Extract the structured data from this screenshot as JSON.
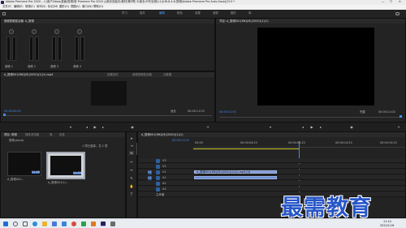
{
  "window": {
    "title": "Adobe Premiere Pro 2020 - 八/用户/ldiao/桌面/剪辑/剪 Premiere Pro 2020 从新手到高手/素材/第9章/ 8.新手/0节/实例(L1)/LRL8.4.8-剪辑(Adobe Premiere Pro Auto-Save)[213 *"
  },
  "menu": [
    "文件(F)",
    "编辑(E)",
    "剪辑(C)",
    "序列(S)",
    "标记(M)",
    "图形(G)",
    "视图(V)",
    "窗口(W)",
    "帮助(H)"
  ],
  "workspaces": [
    {
      "label": "学习",
      "active": false
    },
    {
      "label": "组件",
      "active": false
    },
    {
      "label": "编辑",
      "active": true
    },
    {
      "label": "颜色",
      "active": false
    },
    {
      "label": "效果",
      "active": false
    },
    {
      "label": "音频",
      "active": false
    },
    {
      "label": "图形",
      "active": false
    },
    {
      "label": "库",
      "active": false
    }
  ],
  "audio_mixer": {
    "tab": "音频剪辑混合器: A_剪辑",
    "channels": [
      "音频 1",
      "音频 2",
      "音频 3",
      "音频 4"
    ]
  },
  "source_tabs": [
    "A_剪辑001(MK)(M)(2020)(1)(1).mp4",
    "效果控件",
    "音频剪辑混合器",
    "元数据"
  ],
  "source": {
    "timecode_left": "00:00:00:00",
    "timecode_right": "00:00:11:03",
    "zoom": "适合"
  },
  "program": {
    "tab": "节目: A_剪辑001(MK)(M)(2020)(1)(1)",
    "timecode_left": "00:00:11:03",
    "timecode_right": "00:00:11:03",
    "quality": "完整"
  },
  "project": {
    "tabs": [
      "项目: 剪辑",
      "媒体浏览器",
      "库",
      "信息"
    ],
    "folder": "剪辑.prproj",
    "items_selected": "1 项已选择，共 2 项",
    "clips": [
      {
        "name": "A_剪辑001...",
        "duration": "11:03"
      },
      {
        "name": "A_剪辑001(1)...",
        "duration": "11:03"
      }
    ]
  },
  "timeline": {
    "tab": "A_剪辑001(MK)(M)(2020)(1)(1)",
    "timecode": "00:00:11:03",
    "ruler": [
      "00:00",
      "00:00:04:23",
      "00:00:09:23",
      "00:00:14:23",
      "00:00:19:23"
    ],
    "video_tracks": [
      "V3",
      "V2",
      "V1"
    ],
    "audio_tracks": [
      "A1",
      "A2",
      "A3"
    ],
    "master": "主声道",
    "video_clip": "A_剪辑001(MK)(M)(2020)(1)(1).mp4 [V]",
    "context_menu": [
      "快速编辑工具",
      "波纹编辑工具",
      "滚动编辑工具"
    ]
  },
  "taskbar": {
    "time": "11:14",
    "date": "2022/1/18"
  },
  "watermark": "最需教育",
  "colors": {
    "accent": "#3e8ef0",
    "clip_video": "#7d98d6",
    "clip_audio": "#6a8ed1",
    "watermark": "#2756c8"
  }
}
